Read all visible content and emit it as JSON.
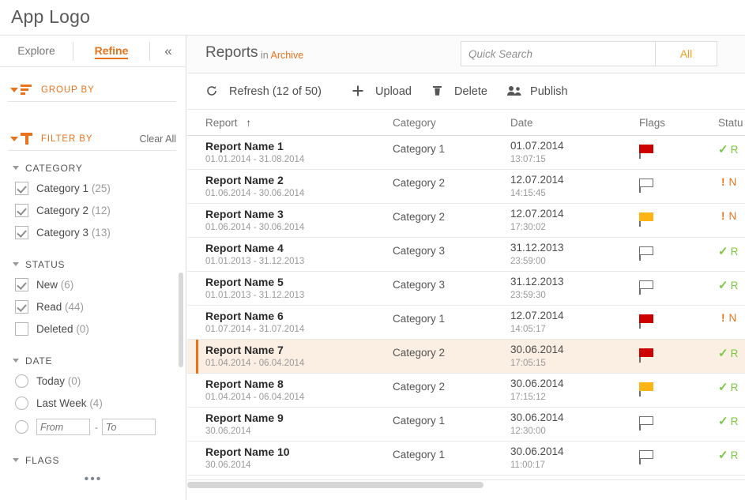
{
  "app": {
    "logo": "App Logo"
  },
  "sidebar": {
    "tabs": [
      {
        "label": "Explore",
        "active": false
      },
      {
        "label": "Refine",
        "active": true
      }
    ],
    "collapse_icon": "chevron-double-left-icon",
    "collapse_glyph": "«",
    "group_by": {
      "label": "GROUP BY",
      "icon": "group-by-icon"
    },
    "filter_by": {
      "label": "FILTER BY",
      "icon": "filter-icon",
      "clear_all": "Clear All"
    },
    "facets": [
      {
        "title": "CATEGORY",
        "control": "checkbox",
        "items": [
          {
            "label": "Category 1",
            "count": "(25)",
            "checked": true
          },
          {
            "label": "Category 2",
            "count": "(12)",
            "checked": true
          },
          {
            "label": "Category 3",
            "count": "(13)",
            "checked": true
          }
        ]
      },
      {
        "title": "STATUS",
        "control": "checkbox",
        "items": [
          {
            "label": "New",
            "count": "(6)",
            "checked": true
          },
          {
            "label": "Read",
            "count": "(44)",
            "checked": true
          },
          {
            "label": "Deleted",
            "count": "(0)",
            "checked": false
          }
        ]
      },
      {
        "title": "DATE",
        "control": "radio",
        "items": [
          {
            "label": "Today",
            "count": "(0)",
            "checked": false
          },
          {
            "label": "Last Week",
            "count": "(4)",
            "checked": false
          }
        ],
        "range": {
          "from_placeholder": "From",
          "from_value": "",
          "to_placeholder": "To",
          "to_value": "",
          "separator": "-"
        }
      },
      {
        "title": "FLAGS",
        "control": "none",
        "items": []
      }
    ],
    "overflow_dots": "•••"
  },
  "main": {
    "title": "Reports",
    "subtitle_prefix": "in ",
    "subtitle_scope": "Archive",
    "search": {
      "placeholder": "Quick Search",
      "value": "",
      "scope_label": "All"
    },
    "toolbar": [
      {
        "label": "Refresh (12 of 50)",
        "icon": "refresh-icon"
      },
      {
        "label": "Upload",
        "icon": "plus-icon"
      },
      {
        "label": "Delete",
        "icon": "trash-icon"
      },
      {
        "label": "Publish",
        "icon": "people-icon"
      }
    ],
    "table": {
      "columns": [
        {
          "key": "report",
          "label": "Report",
          "sorted": "asc",
          "sort_glyph": "↑"
        },
        {
          "key": "category",
          "label": "Category"
        },
        {
          "key": "date",
          "label": "Date"
        },
        {
          "key": "flags",
          "label": "Flags"
        },
        {
          "key": "status",
          "label": "Statu"
        }
      ],
      "rows": [
        {
          "name": "Report Name 1",
          "range": "01.01.2014 - 31.08.2014",
          "category": "Category 1",
          "date": "01.07.2014",
          "time": "13:07:15",
          "flag": "red",
          "status": "R",
          "status_type": "read",
          "selected": false
        },
        {
          "name": "Report Name 2",
          "range": "01.06.2014 - 30.06.2014",
          "category": "Category 2",
          "date": "12.07.2014",
          "time": "14:15:45",
          "flag": "none",
          "status": "N",
          "status_type": "new",
          "selected": false
        },
        {
          "name": "Report Name 3",
          "range": "01.06.2014 - 30.06.2014",
          "category": "Category 2",
          "date": "12.07.2014",
          "time": "17:30:02",
          "flag": "yellow",
          "status": "N",
          "status_type": "new",
          "selected": false
        },
        {
          "name": "Report Name 4",
          "range": "01.01.2013 - 31.12.2013",
          "category": "Category 3",
          "date": "31.12.2013",
          "time": "23:59:00",
          "flag": "none",
          "status": "R",
          "status_type": "read",
          "selected": false
        },
        {
          "name": "Report Name 5",
          "range": "01.01.2013 - 31.12.2013",
          "category": "Category 3",
          "date": "31.12.2013",
          "time": "23:59:30",
          "flag": "none",
          "status": "R",
          "status_type": "read",
          "selected": false
        },
        {
          "name": "Report Name 6",
          "range": "01.07.2014 - 31.07.2014",
          "category": "Category 1",
          "date": "12.07.2014",
          "time": "14:05:17",
          "flag": "red",
          "status": "N",
          "status_type": "new",
          "selected": false
        },
        {
          "name": "Report Name 7",
          "range": "01.04.2014 - 06.04.2014",
          "category": "Category 2",
          "date": "30.06.2014",
          "time": "17:05:15",
          "flag": "red",
          "status": "R",
          "status_type": "read",
          "selected": true
        },
        {
          "name": "Report Name 8",
          "range": "01.04.2014 - 06.04.2014",
          "category": "Category 2",
          "date": "30.06.2014",
          "time": "17:15:12",
          "flag": "yellow",
          "status": "R",
          "status_type": "read",
          "selected": false
        },
        {
          "name": "Report Name 9",
          "range": "30.06.2014",
          "category": "Category 1",
          "date": "30.06.2014",
          "time": "12:30:00",
          "flag": "none",
          "status": "R",
          "status_type": "read",
          "selected": false
        },
        {
          "name": "Report Name 10",
          "range": "30.06.2014",
          "category": "Category 1",
          "date": "30.06.2014",
          "time": "11:00:17",
          "flag": "none",
          "status": "R",
          "status_type": "read",
          "selected": false
        }
      ]
    }
  },
  "colors": {
    "accent": "#e8731c",
    "accent_soft": "#fbeee2",
    "search_scope": "#f0a020",
    "status_read": "#7ac943",
    "status_new": "#e8731c",
    "flag_red": "#cc0000",
    "flag_yellow": "#fcb515",
    "text": "#4b4b4b",
    "muted": "#9a9a9a",
    "border": "#e2e2e2"
  }
}
